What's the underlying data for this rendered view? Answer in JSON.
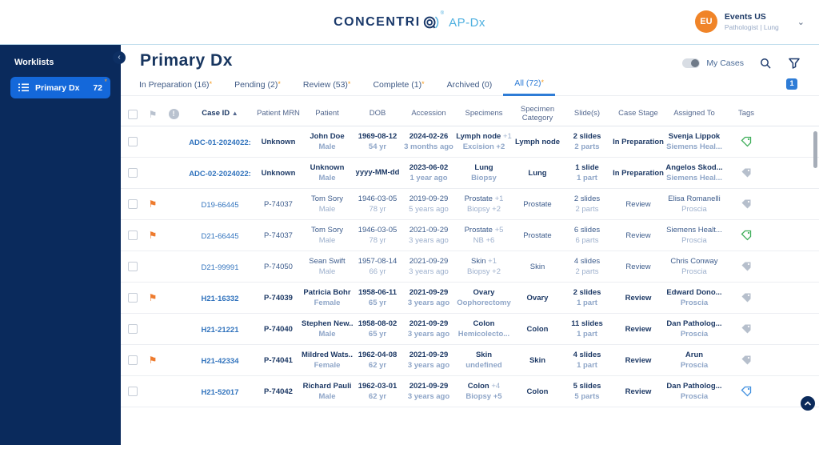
{
  "header": {
    "logo_text": "CONCENTRI",
    "logo_reg": "®",
    "logo_suffix": "AP-Dx",
    "user": {
      "initials": "EU",
      "name": "Events US",
      "role": "Pathologist | Lung"
    }
  },
  "sidebar": {
    "title": "Worklists",
    "items": [
      {
        "label": "Primary Dx",
        "count": "72",
        "starred": true
      }
    ]
  },
  "page": {
    "title": "Primary Dx",
    "my_cases_label": "My Cases",
    "page_badge": "1"
  },
  "tabs": [
    {
      "label": "In Preparation (16)",
      "starred": true,
      "active": false
    },
    {
      "label": "Pending (2)",
      "starred": true,
      "active": false
    },
    {
      "label": "Review (53)",
      "starred": true,
      "active": false
    },
    {
      "label": "Complete (1)",
      "starred": true,
      "active": false
    },
    {
      "label": "Archived (0)",
      "starred": false,
      "active": false
    },
    {
      "label": "All (72)",
      "starred": true,
      "active": true
    }
  ],
  "table": {
    "columns": [
      "Case ID",
      "Patient MRN",
      "Patient",
      "DOB",
      "Accession",
      "Specimens",
      "Specimen Category",
      "Slide(s)",
      "Case Stage",
      "Assigned To",
      "Tags"
    ],
    "rows": [
      {
        "flag": false,
        "bold": true,
        "case_id": "ADC-01-2024022:",
        "mrn": "Unknown",
        "patient": "John Doe",
        "patient_sub": "Male",
        "dob": "1969-08-12",
        "dob_sub": "54 yr",
        "accession": "2024-02-26",
        "accession_sub": "3 months ago",
        "specimen": "Lymph node",
        "specimen_suffix": "+1",
        "specimen_sub": "Excision +2",
        "category": "Lymph node",
        "slides": "2 slides",
        "slides_sub": "2 parts",
        "stage": "In Preparation",
        "assigned": "Svenja Lippok",
        "assigned_sub": "Siemens Heal...",
        "tag": "green"
      },
      {
        "flag": false,
        "bold": true,
        "case_id": "ADC-02-2024022:",
        "mrn": "Unknown",
        "patient": "Unknown",
        "patient_sub": "Male",
        "dob": "yyyy-MM-dd",
        "dob_sub": "",
        "accession": "2023-06-02",
        "accession_sub": "1 year ago",
        "specimen": "Lung",
        "specimen_suffix": "",
        "specimen_sub": "Biopsy",
        "category": "Lung",
        "slides": "1 slide",
        "slides_sub": "1 part",
        "stage": "In Preparation",
        "assigned": "Angelos Skod...",
        "assigned_sub": "Siemens Heal...",
        "tag": "gray"
      },
      {
        "flag": true,
        "bold": false,
        "case_id": "D19-66445",
        "mrn": "P-74037",
        "patient": "Tom Sory",
        "patient_sub": "Male",
        "dob": "1946-03-05",
        "dob_sub": "78 yr",
        "accession": "2019-09-29",
        "accession_sub": "5 years ago",
        "specimen": "Prostate",
        "specimen_suffix": "+1",
        "specimen_sub": "Biopsy +2",
        "category": "Prostate",
        "slides": "2 slides",
        "slides_sub": "2 parts",
        "stage": "Review",
        "assigned": "Elisa Romanelli",
        "assigned_sub": "Proscia",
        "tag": "gray"
      },
      {
        "flag": true,
        "bold": false,
        "case_id": "D21-66445",
        "mrn": "P-74037",
        "patient": "Tom Sory",
        "patient_sub": "Male",
        "dob": "1946-03-05",
        "dob_sub": "78 yr",
        "accession": "2021-09-29",
        "accession_sub": "3 years ago",
        "specimen": "Prostate",
        "specimen_suffix": "+5",
        "specimen_sub": "NB +6",
        "category": "Prostate",
        "slides": "6 slides",
        "slides_sub": "6 parts",
        "stage": "Review",
        "assigned": "Siemens Healt...",
        "assigned_sub": "Proscia",
        "tag": "green"
      },
      {
        "flag": false,
        "bold": false,
        "case_id": "D21-99991",
        "mrn": "P-74050",
        "patient": "Sean Swift",
        "patient_sub": "Male",
        "dob": "1957-08-14",
        "dob_sub": "66 yr",
        "accession": "2021-09-29",
        "accession_sub": "3 years ago",
        "specimen": "Skin",
        "specimen_suffix": "+1",
        "specimen_sub": "Biopsy +2",
        "category": "Skin",
        "slides": "4 slides",
        "slides_sub": "2 parts",
        "stage": "Review",
        "assigned": "Chris Conway",
        "assigned_sub": "Proscia",
        "tag": "gray"
      },
      {
        "flag": true,
        "bold": true,
        "case_id": "H21-16332",
        "mrn": "P-74039",
        "patient": "Patricia Bohr",
        "patient_sub": "Female",
        "dob": "1958-06-11",
        "dob_sub": "65 yr",
        "accession": "2021-09-29",
        "accession_sub": "3 years ago",
        "specimen": "Ovary",
        "specimen_suffix": "",
        "specimen_sub": "Oophorectomy",
        "category": "Ovary",
        "slides": "2 slides",
        "slides_sub": "1 part",
        "stage": "Review",
        "assigned": "Edward Dono...",
        "assigned_sub": "Proscia",
        "tag": "gray"
      },
      {
        "flag": false,
        "bold": true,
        "case_id": "H21-21221",
        "mrn": "P-74040",
        "patient": "Stephen New...",
        "patient_sub": "Male",
        "dob": "1958-08-02",
        "dob_sub": "65 yr",
        "accession": "2021-09-29",
        "accession_sub": "3 years ago",
        "specimen": "Colon",
        "specimen_suffix": "",
        "specimen_sub": "Hemicolecto...",
        "category": "Colon",
        "slides": "11 slides",
        "slides_sub": "1 part",
        "stage": "Review",
        "assigned": "Dan Patholog...",
        "assigned_sub": "Proscia",
        "tag": "gray"
      },
      {
        "flag": true,
        "bold": true,
        "case_id": "H21-42334",
        "mrn": "P-74041",
        "patient": "Mildred Wats...",
        "patient_sub": "Female",
        "dob": "1962-04-08",
        "dob_sub": "62 yr",
        "accession": "2021-09-29",
        "accession_sub": "3 years ago",
        "specimen": "Skin",
        "specimen_suffix": "",
        "specimen_sub": "undefined",
        "category": "Skin",
        "slides": "4 slides",
        "slides_sub": "1 part",
        "stage": "Review",
        "assigned": "Arun",
        "assigned_sub": "Proscia",
        "tag": "gray"
      },
      {
        "flag": false,
        "bold": true,
        "case_id": "H21-52017",
        "mrn": "P-74042",
        "patient": "Richard Pauli",
        "patient_sub": "Male",
        "dob": "1962-03-01",
        "dob_sub": "62 yr",
        "accession": "2021-09-29",
        "accession_sub": "3 years ago",
        "specimen": "Colon",
        "specimen_suffix": "+4",
        "specimen_sub": "Biopsy +5",
        "category": "Colon",
        "slides": "5 slides",
        "slides_sub": "5 parts",
        "stage": "Review",
        "assigned": "Dan Patholog...",
        "assigned_sub": "Proscia",
        "tag": "blue"
      }
    ]
  }
}
